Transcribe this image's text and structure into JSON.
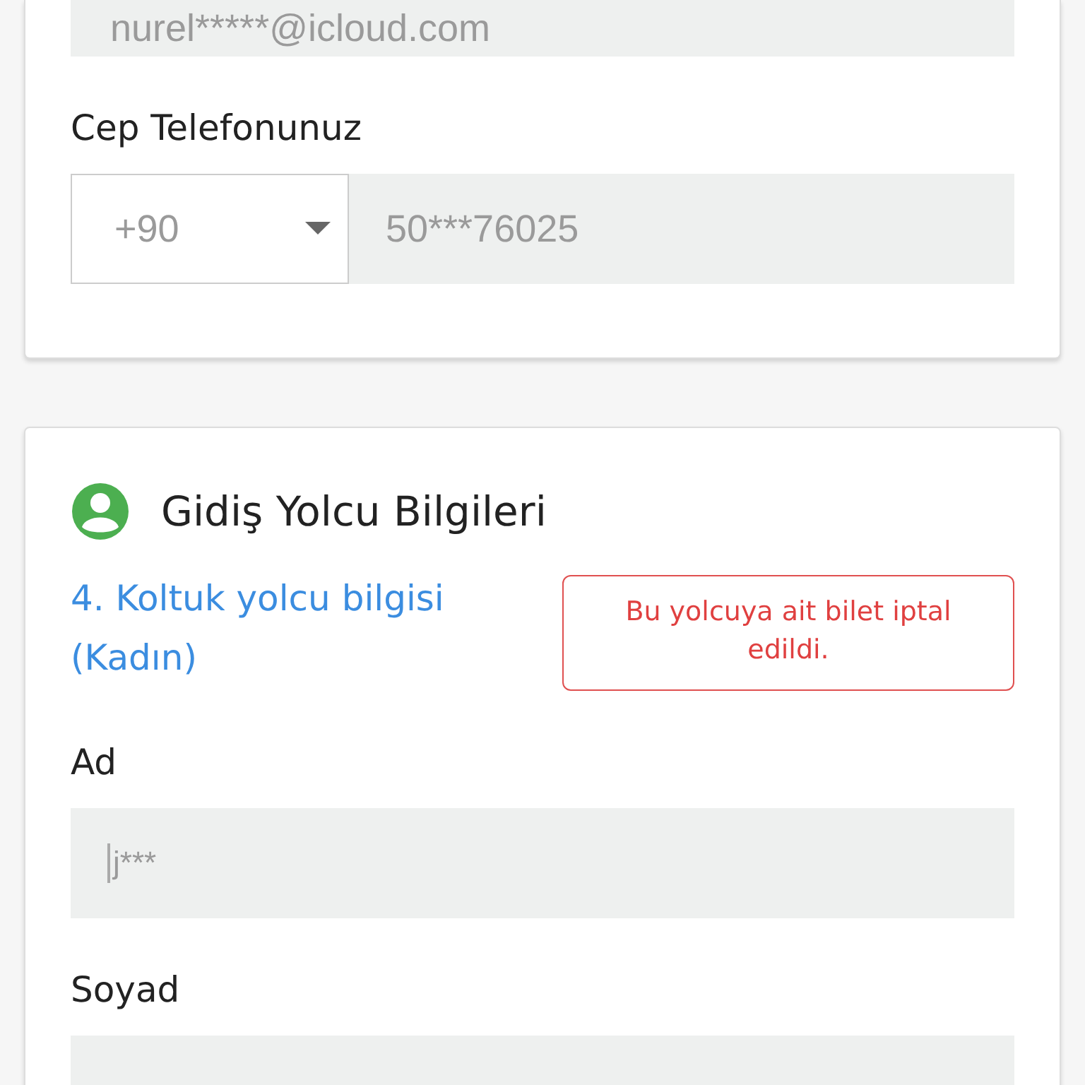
{
  "contact_card": {
    "email_field": {
      "value": "nurel*****@icloud.com"
    },
    "phone_label": "Cep Telefonunuz",
    "country_code": {
      "value": "+90"
    },
    "phone_field": {
      "value": "50***76025"
    }
  },
  "passenger_card": {
    "title": "Gidiş Yolcu Bilgileri",
    "seat_info": "4. Koltuk yolcu bilgisi (Kadın)",
    "alert": "Bu yolcuya ait bilet iptal edildi.",
    "fields": [
      {
        "label": "Ad",
        "value": "j***",
        "focused": true
      },
      {
        "label": "Soyad",
        "focused": false
      }
    ]
  }
}
